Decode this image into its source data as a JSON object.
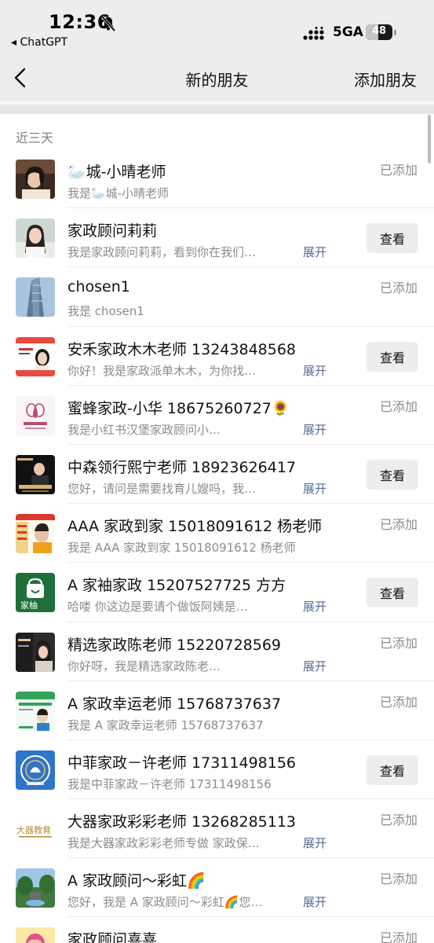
{
  "status_bar": {
    "time": "12:36",
    "back_app": "◂ ChatGPT",
    "network": "5GA",
    "battery_percent": 48,
    "battery_label": "48"
  },
  "nav": {
    "title": "新的朋友",
    "action": "添加朋友"
  },
  "section": {
    "label": "近三天"
  },
  "labels": {
    "added": "已添加",
    "view": "查看",
    "expand": "展开"
  },
  "friends": [
    {
      "name": "🦢城-小晴老师",
      "message": "我是🦢城-小晴老师",
      "status": "added",
      "expand": false
    },
    {
      "name": "家政顾问莉莉",
      "message": "我是家政顾问莉莉，看到你在我们…",
      "status": "view",
      "expand": true
    },
    {
      "name": "chosen1",
      "message": "我是 chosen1",
      "status": "added",
      "expand": false
    },
    {
      "name": "安禾家政木木老师 13243848568",
      "message": "你好！我是家政派单木木，为你找…",
      "status": "view",
      "expand": true
    },
    {
      "name": "蜜蜂家政-小华 18675260727🌻",
      "message": "我是小红书汉堡家政顾问小…",
      "status": "added",
      "expand": true
    },
    {
      "name": "中森领行熙宁老师 18923626417",
      "message": "您好，请问是需要找育儿嫂吗，我…",
      "status": "view",
      "expand": true
    },
    {
      "name": "AAA  家政到家 15018091612 杨老师",
      "message": "我是 AAA  家政到家 15018091612 杨老师",
      "status": "added",
      "expand": false
    },
    {
      "name": "A 家袖家政 15207527725 方方",
      "message": "哈喽   你这边是要请个做饭阿姨是…",
      "status": "view",
      "expand": true
    },
    {
      "name": "精选家政陈老师 15220728569",
      "message": "你好呀，我是精选家政陈老…",
      "status": "added",
      "expand": true
    },
    {
      "name": "A 家政幸运老师 15768737637",
      "message": "我是 A 家政幸运老师 15768737637",
      "status": "added",
      "expand": false
    },
    {
      "name": "中菲家政－许老师 17311498156",
      "message": "我是中菲家政－许老师 17311498156",
      "status": "view",
      "expand": false
    },
    {
      "name": "大器家政彩彩老师 13268285113",
      "message": "我是大器家政彩彩老师专做 家政保…",
      "status": "added",
      "expand": true
    },
    {
      "name": "A 家政顾问～彩虹🌈",
      "message": "您好，我是 A 家政顾问～彩虹🌈您…",
      "status": "added",
      "expand": true
    },
    {
      "name": "家政顾问喜喜",
      "message": "",
      "status": "added",
      "expand": false
    }
  ],
  "avatars": {
    "item_9_text": "家柚",
    "item_12_text": "大器教育"
  },
  "colors": {
    "nav_bg": "#ededed",
    "link": "#576b95",
    "secondary_text": "#8c8c8c",
    "button_bg": "#ededed"
  }
}
